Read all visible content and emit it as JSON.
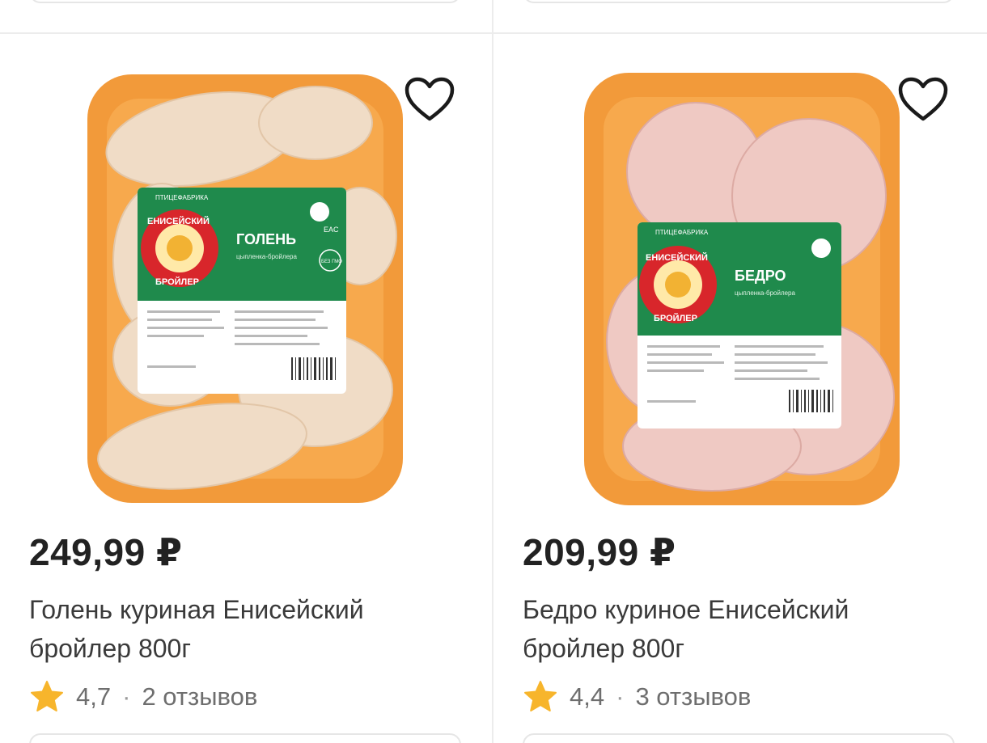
{
  "products": [
    {
      "price": "249,99 ₽",
      "title": "Голень куриная Енисейский бройлер 800г",
      "rating": "4,7",
      "separator": "·",
      "reviews": "2 отзывов",
      "label_brand": "ЕНИСЕЙСКИЙ",
      "label_brand2": "БРОЙЛЕР",
      "label_name": "ГОЛЕНЬ",
      "label_top": "ПТИЦЕФАБРИКА",
      "label_sub": "цыпленка-бройлера",
      "badge_eac": "EAC",
      "badge_gmo": "БЕЗ ГМО"
    },
    {
      "price": "209,99 ₽",
      "title": "Бедро куриное Енисейский бройлер 800г",
      "rating": "4,4",
      "separator": "·",
      "reviews": "3 отзывов",
      "label_brand": "ЕНИСЕЙСКИЙ",
      "label_brand2": "БРОЙЛЕР",
      "label_name": "БЕДРО",
      "label_top": "ПТИЦЕФАБРИКА",
      "label_sub": "цыпленка-бройлера"
    }
  ],
  "colors": {
    "tray": "#f29a3a",
    "tray_inner": "#f7a94d",
    "label_green": "#1f8a4c",
    "label_red": "#d8262b",
    "star": "#f7b52c",
    "heart_stroke": "#1a1a1a"
  },
  "icons": {
    "favorite": "heart-outline-icon",
    "rating": "star-icon"
  }
}
